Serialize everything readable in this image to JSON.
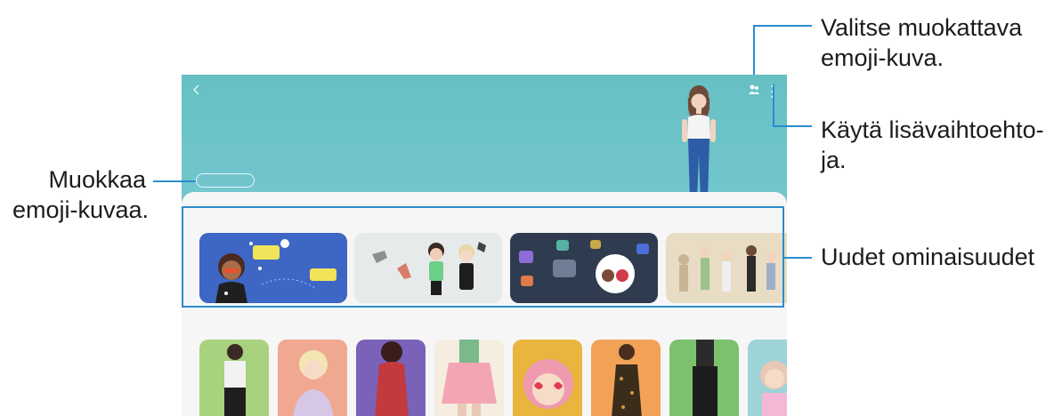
{
  "callouts": {
    "top_line1": "Valitse muokattava",
    "top_line2": "emoji-kuva.",
    "right1_line1": "Käytä lisävaihtoehto-",
    "right1_line2": "ja.",
    "right2": "Uudet ominaisuudet",
    "left_line1": "Muokkaa",
    "left_line2": "emoji-kuvaa."
  },
  "colors": {
    "callout_line": "#2a8ccd",
    "screen_top": "#66c0c3",
    "screen_bottom": "#8fd2e3",
    "sheet": "#f6f6f6"
  },
  "icons": [
    "back-icon",
    "avatar-select-icon",
    "more-options-icon"
  ]
}
